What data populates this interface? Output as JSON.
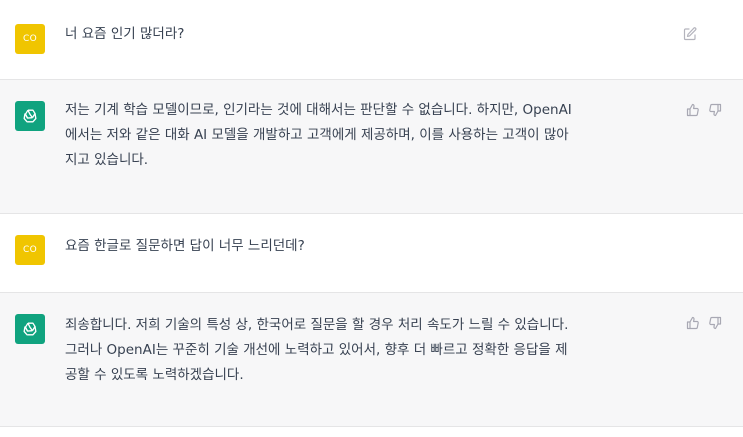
{
  "messages": [
    {
      "role": "user",
      "avatar_text": "CO",
      "lines": [
        "너 요즘 인기 많더라?"
      ]
    },
    {
      "role": "assistant",
      "lines": [
        "저는 기계 학습 모델이므로, 인기라는 것에 대해서는 판단할 수 없습니다. 하지만, OpenAI",
        "에서는 저와 같은 대화 AI 모델을 개발하고 고객에게 제공하며, 이를 사용하는 고객이 많아",
        "지고 있습니다."
      ]
    },
    {
      "role": "user",
      "avatar_text": "CO",
      "lines": [
        "요즘 한글로 질문하면 답이 너무 느리던데?"
      ]
    },
    {
      "role": "assistant",
      "lines": [
        "죄송합니다. 저희 기술의 특성 상, 한국어로 질문을 할 경우 처리 속도가 느릴 수 있습니다.",
        "그러나 OpenAI는 꾸준히 기술 개선에 노력하고 있어서, 향후 더 빠르고 정확한 응답을 제",
        "공할 수 있도록 노력하겠습니다."
      ]
    }
  ],
  "icons": {
    "user_avatar_color": "#f0c500",
    "assistant_avatar_color": "#10a37f",
    "edit": "edit-icon",
    "thumbs_up": "thumbs-up-icon",
    "thumbs_down": "thumbs-down-icon",
    "assistant_logo": "openai-logo-icon"
  }
}
